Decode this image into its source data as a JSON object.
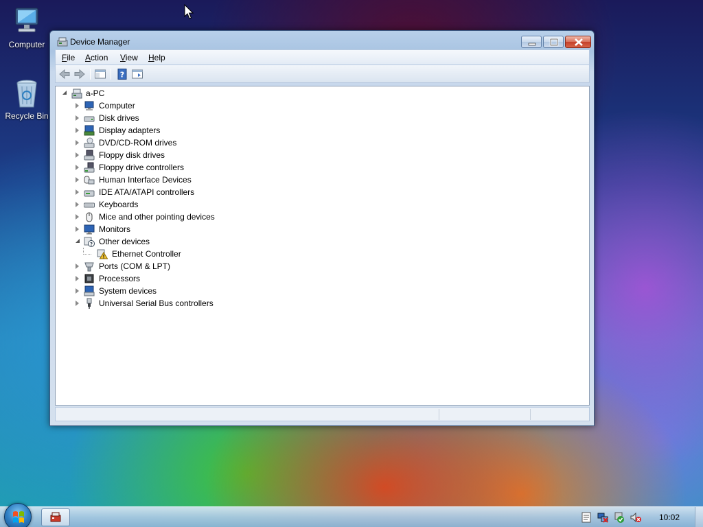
{
  "desktop": {
    "icons": [
      {
        "label": "Computer"
      },
      {
        "label": "Recycle Bin"
      }
    ]
  },
  "window": {
    "title": "Device Manager",
    "menu": [
      {
        "label": "File",
        "accel": "F",
        "rest": "ile"
      },
      {
        "label": "Action",
        "accel": "A",
        "rest": "ction"
      },
      {
        "label": "View",
        "accel": "V",
        "rest": "iew"
      },
      {
        "label": "Help",
        "accel": "H",
        "rest": "elp"
      }
    ],
    "toolbar": [
      "back-icon",
      "forward-icon",
      "show-hide-console-tree-icon",
      "help-icon",
      "properties-icon"
    ],
    "tree": {
      "root": "a-PC",
      "items": [
        {
          "label": "Computer",
          "expanded": false,
          "icon": "computer-icon"
        },
        {
          "label": "Disk drives",
          "expanded": false,
          "icon": "disk-drive-icon"
        },
        {
          "label": "Display adapters",
          "expanded": false,
          "icon": "display-adapter-icon"
        },
        {
          "label": "DVD/CD-ROM drives",
          "expanded": false,
          "icon": "dvd-drive-icon"
        },
        {
          "label": "Floppy disk drives",
          "expanded": false,
          "icon": "floppy-disk-icon"
        },
        {
          "label": "Floppy drive controllers",
          "expanded": false,
          "icon": "floppy-controller-icon"
        },
        {
          "label": "Human Interface Devices",
          "expanded": false,
          "icon": "hid-icon"
        },
        {
          "label": "IDE ATA/ATAPI controllers",
          "expanded": false,
          "icon": "ide-controller-icon"
        },
        {
          "label": "Keyboards",
          "expanded": false,
          "icon": "keyboard-icon"
        },
        {
          "label": "Mice and other pointing devices",
          "expanded": false,
          "icon": "mouse-icon"
        },
        {
          "label": "Monitors",
          "expanded": false,
          "icon": "monitor-icon"
        },
        {
          "label": "Other devices",
          "expanded": true,
          "icon": "unknown-device-icon",
          "children": [
            {
              "label": "Ethernet Controller",
              "icon": "warning-device-icon"
            }
          ]
        },
        {
          "label": "Ports (COM & LPT)",
          "expanded": false,
          "icon": "port-icon"
        },
        {
          "label": "Processors",
          "expanded": false,
          "icon": "processor-icon"
        },
        {
          "label": "System devices",
          "expanded": false,
          "icon": "system-device-icon"
        },
        {
          "label": "Universal Serial Bus controllers",
          "expanded": false,
          "icon": "usb-icon"
        }
      ]
    }
  },
  "taskbar": {
    "clock": "10:02",
    "tray": [
      "action-center-icon",
      "network-icon",
      "security-icon",
      "volume-muted-icon"
    ]
  },
  "colors": {
    "window_frame": "#3d5a82",
    "close_button": "#c4402a",
    "warning": "#f2c230"
  }
}
